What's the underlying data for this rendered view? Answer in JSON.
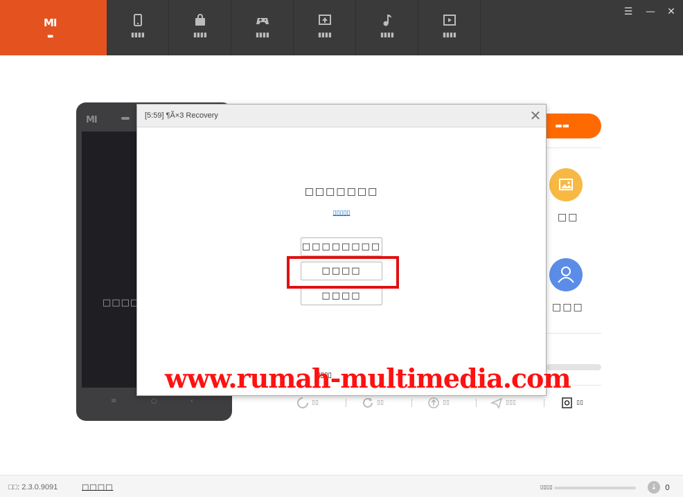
{
  "topbar": {
    "home": {
      "logo": "MI",
      "label": "▬"
    },
    "tabs": [
      {
        "icon": "phone-icon",
        "label": "▮▮▮▮"
      },
      {
        "icon": "shopping-bag-icon",
        "label": "▮▮▮▮"
      },
      {
        "icon": "gamepad-icon",
        "label": "▮▮▮▮"
      },
      {
        "icon": "wallpaper-icon",
        "label": "▮▮▮▮"
      },
      {
        "icon": "music-note-icon",
        "label": "▮▮▮▮"
      },
      {
        "icon": "video-icon",
        "label": "▮▮▮▮"
      }
    ],
    "window_controls": {
      "menu": "☰",
      "minimize": "—",
      "close": "✕"
    }
  },
  "phone": {
    "brand": "MI",
    "screen_text": "□□□□U",
    "keys": [
      "≡",
      "○",
      "‹"
    ]
  },
  "right_panel": {
    "button_label": "▬▬",
    "items": [
      {
        "icon": "image-icon",
        "label": "□□",
        "color": "#f7b944"
      },
      {
        "icon": "user-icon",
        "label": "□□□",
        "color": "#5b8de8"
      }
    ]
  },
  "toolbar": {
    "items": [
      {
        "icon": "backup-icon",
        "label": "▯▯"
      },
      {
        "icon": "restore-icon",
        "label": "▯▯"
      },
      {
        "icon": "upgrade-icon",
        "label": "▯▯"
      },
      {
        "icon": "send-icon",
        "label": "▯▯▯"
      },
      {
        "icon": "screenshot-icon",
        "label": "▯▯"
      }
    ]
  },
  "dialog": {
    "title": "[5:59] ¶Ã×3 Recovery",
    "close": "✕",
    "message": "□□□□□□□",
    "link": "▯▯▯▯▯",
    "buttons": [
      "□□□□□□□□",
      "□□□□",
      "□□□□"
    ],
    "footer": "▯▯▯▯"
  },
  "watermark": "www.rumah-multimedia.com",
  "statusbar": {
    "version": "□□: 2.3.0.9091",
    "link": "□□□□",
    "speed": "▯▯▯▯",
    "downloads": "0"
  },
  "colors": {
    "brand": "#e4531f",
    "accent": "#ff6a00",
    "highlight": "#e01010",
    "topbar_bg": "#3a3a3a"
  }
}
